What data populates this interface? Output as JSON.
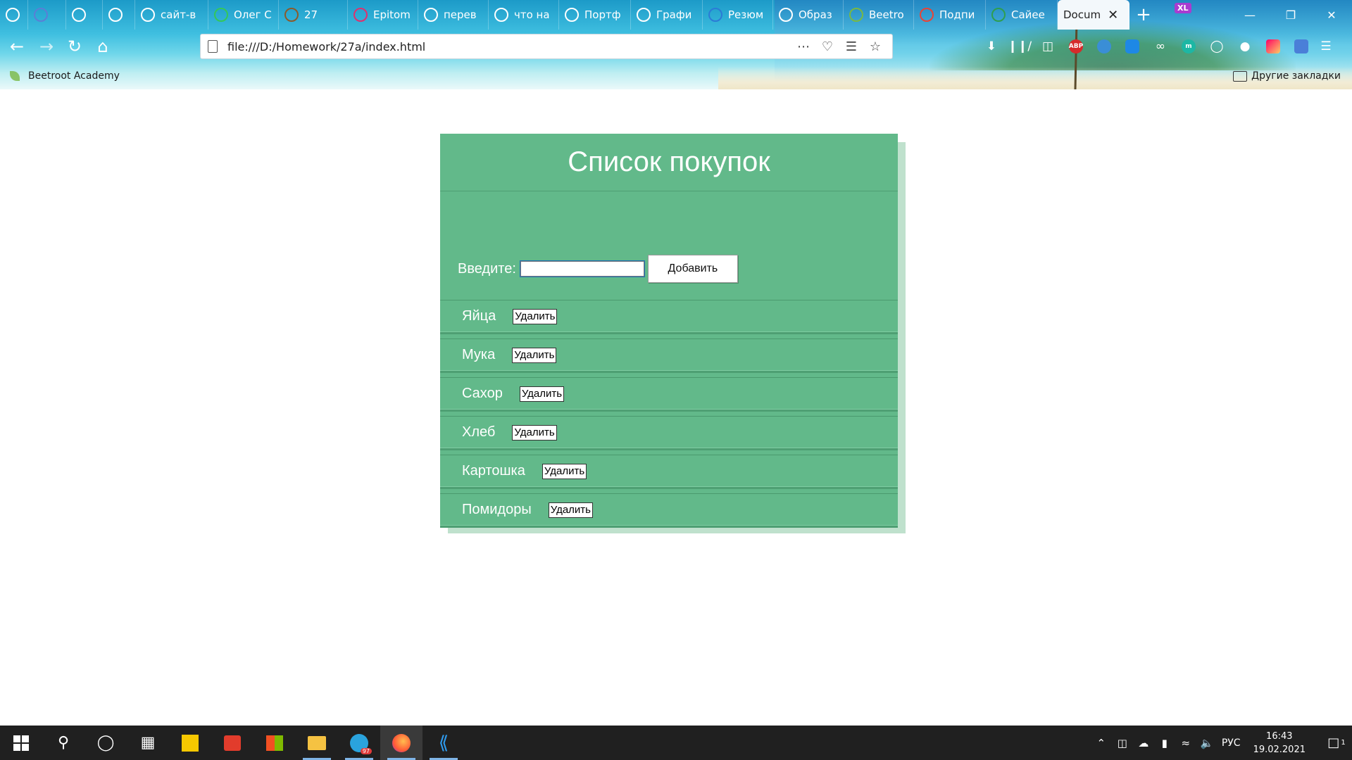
{
  "browser": {
    "tabs": [
      {
        "label": "",
        "icon": "extension-icon",
        "color": "#ffffff"
      },
      {
        "label": "",
        "icon": "globe-icon",
        "color": "#5a7fd6"
      },
      {
        "label": "",
        "icon": "globe-icon",
        "color": "#ffffff"
      },
      {
        "label": "",
        "icon": "wordpress-icon",
        "color": "#ffffff"
      },
      {
        "label": "сайт-в",
        "icon": "google-icon",
        "color": "#ffffff"
      },
      {
        "label": "Олег С",
        "icon": "search-icon",
        "color": "#34c759"
      },
      {
        "label": "27",
        "icon": "briefcase-icon",
        "color": "#8b5a2b"
      },
      {
        "label": "Epitom",
        "icon": "e-icon",
        "color": "#e0306e"
      },
      {
        "label": "перев",
        "icon": "google-icon",
        "color": "#ffffff"
      },
      {
        "label": "что на",
        "icon": "google-icon",
        "color": "#ffffff"
      },
      {
        "label": "Портф",
        "icon": "html-icon",
        "color": "#ffffff"
      },
      {
        "label": "Графи",
        "icon": "google-icon",
        "color": "#ffffff"
      },
      {
        "label": "Резюм",
        "icon": "resume-icon",
        "color": "#2b7bd6"
      },
      {
        "label": "Образ",
        "icon": "question-icon",
        "color": "#ffffff"
      },
      {
        "label": "Beetro",
        "icon": "leaf-icon",
        "color": "#79b843"
      },
      {
        "label": "Подпи",
        "icon": "gmail-icon",
        "color": "#ea4335"
      },
      {
        "label": "Сайее",
        "icon": "check-icon",
        "color": "#2e9e4f"
      },
      {
        "label": "Docum",
        "icon": "",
        "color": "#222222",
        "active": true
      }
    ],
    "url": "file:///D:/Homework/27a/index.html",
    "bookmarks": {
      "left": "Beetroot Academy",
      "right": "Другие закладки"
    },
    "ext_badge": "XL",
    "abp_label": "ABP",
    "m_label": "m"
  },
  "app": {
    "title": "Список покупок",
    "input_label": "Введите:",
    "input_value": "",
    "add_label": "Добавить",
    "delete_label": "Удалить",
    "items": [
      {
        "name": "Яйца"
      },
      {
        "name": "Мука"
      },
      {
        "name": "Сахор"
      },
      {
        "name": "Хлеб"
      },
      {
        "name": "Картошка"
      },
      {
        "name": "Помидоры"
      }
    ],
    "colors": {
      "panel": "#62b98a",
      "shadow": "#bfe1cd",
      "text": "#ffffff"
    }
  },
  "taskbar": {
    "language": "РУС",
    "time": "16:43",
    "date": "19.02.2021",
    "telegram_badge": "97",
    "notifications_count": "1"
  }
}
